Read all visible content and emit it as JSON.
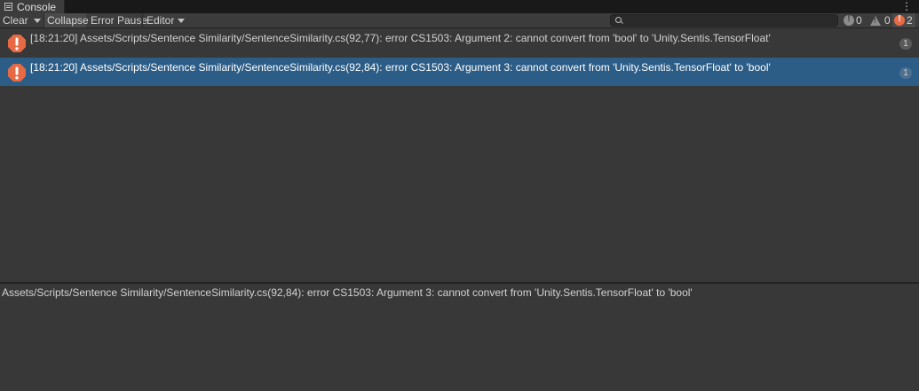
{
  "tab": {
    "title": "Console"
  },
  "toolbar": {
    "clear_label": "Clear",
    "collapse_label": "Collapse",
    "error_pause_label": "Error Pause",
    "editor_label": "Editor",
    "search": {
      "value": "",
      "placeholder": ""
    },
    "counts": {
      "info": "0",
      "warnings": "0",
      "errors": "2"
    }
  },
  "logs": [
    {
      "text": "[18:21:20] Assets/Scripts/Sentence Similarity/SentenceSimilarity.cs(92,77): error CS1503: Argument 2: cannot convert from 'bool' to 'Unity.Sentis.TensorFloat'",
      "count": "1",
      "icon": "error-icon",
      "selected": false
    },
    {
      "text": "[18:21:20] Assets/Scripts/Sentence Similarity/SentenceSimilarity.cs(92,84): error CS1503: Argument 3: cannot convert from 'Unity.Sentis.TensorFloat' to 'bool'",
      "count": "1",
      "icon": "error-icon",
      "selected": true
    }
  ],
  "detail": {
    "text": "Assets/Scripts/Sentence Similarity/SentenceSimilarity.cs(92,84): error CS1503: Argument 3: cannot convert from 'Unity.Sentis.TensorFloat' to 'bool'"
  },
  "colors": {
    "background": "#383838",
    "selected_row": "#2c5d87",
    "error": "#e86a45"
  }
}
